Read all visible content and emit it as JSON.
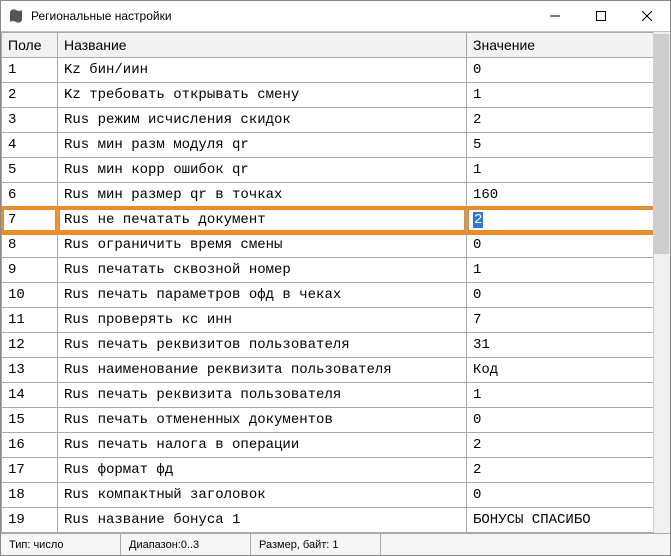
{
  "window": {
    "title": "Региональные настройки",
    "icon_name": "app-icon"
  },
  "table": {
    "headers": {
      "field": "Поле",
      "name": "Название",
      "value": "Значение"
    },
    "rows": [
      {
        "field": "1",
        "name": "Kz бин/иин",
        "value": "0"
      },
      {
        "field": "2",
        "name": "Kz требовать открывать смену",
        "value": "1"
      },
      {
        "field": "3",
        "name": "Rus режим исчисления скидок",
        "value": "2"
      },
      {
        "field": "4",
        "name": "Rus мин разм модуля qr",
        "value": "5"
      },
      {
        "field": "5",
        "name": "Rus мин корр ошибок qr",
        "value": "1"
      },
      {
        "field": "6",
        "name": "Rus мин размер qr в точках",
        "value": "160"
      },
      {
        "field": "7",
        "name": "Rus не печатать документ",
        "value": "2",
        "highlight": true
      },
      {
        "field": "8",
        "name": "Rus ограничить время смены",
        "value": "0"
      },
      {
        "field": "9",
        "name": "Rus печатать сквозной номер",
        "value": "1"
      },
      {
        "field": "10",
        "name": "Rus печать параметров офд в чеках",
        "value": "0"
      },
      {
        "field": "11",
        "name": "Rus проверять кс инн",
        "value": "7"
      },
      {
        "field": "12",
        "name": "Rus печать реквизитов пользователя",
        "value": "31"
      },
      {
        "field": "13",
        "name": "Rus наименование реквизита пользователя",
        "value": "Код"
      },
      {
        "field": "14",
        "name": "Rus печать реквизита пользователя",
        "value": "1"
      },
      {
        "field": "15",
        "name": "Rus печать отмененных документов",
        "value": "0"
      },
      {
        "field": "16",
        "name": "Rus печать налога в операции",
        "value": "2"
      },
      {
        "field": "17",
        "name": "Rus формат фд",
        "value": "2"
      },
      {
        "field": "18",
        "name": "Rus компактный заголовок",
        "value": "0"
      },
      {
        "field": "19",
        "name": "Rus название бонуса 1",
        "value": "БОНУСЫ СПАСИБО"
      }
    ]
  },
  "statusbar": {
    "type_label": "Тип: число",
    "range_label": "Диапазон:0..3",
    "size_label": "Размер, байт: 1"
  }
}
